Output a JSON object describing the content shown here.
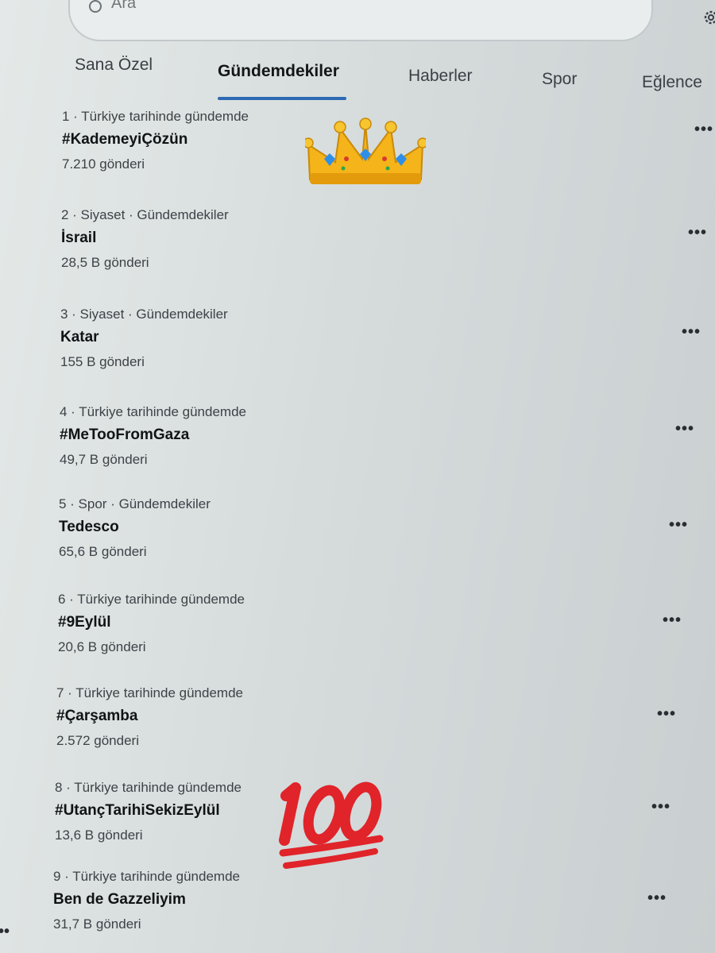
{
  "search": {
    "placeholder": "Ara"
  },
  "tabs": [
    {
      "label": "Sana Özel"
    },
    {
      "label": "Gündemdekiler",
      "active": true
    },
    {
      "label": "Haberler"
    },
    {
      "label": "Spor"
    },
    {
      "label": "Eğlence"
    }
  ],
  "trends": [
    {
      "meta": "1 · Türkiye tarihinde gündemde",
      "name": "#KademeyiÇözün",
      "count": "7.210 gönderi"
    },
    {
      "meta": "2 · Siyaset · Gündemdekiler",
      "name": "İsrail",
      "count": "28,5 B gönderi"
    },
    {
      "meta": "3 · Siyaset · Gündemdekiler",
      "name": "Katar",
      "count": "155 B gönderi"
    },
    {
      "meta": "4 · Türkiye tarihinde gündemde",
      "name": "#MeTooFromGaza",
      "count": "49,7 B gönderi"
    },
    {
      "meta": "5 · Spor · Gündemdekiler",
      "name": "Tedesco",
      "count": "65,6 B gönderi"
    },
    {
      "meta": "6 · Türkiye tarihinde gündemde",
      "name": "#9Eylül",
      "count": "20,6 B gönderi"
    },
    {
      "meta": "7 · Türkiye tarihinde gündemde",
      "name": "#Çarşamba",
      "count": "2.572 gönderi"
    },
    {
      "meta": "8 · Türkiye tarihinde gündemde",
      "name": "#UtançTarihiSekizEylül",
      "count": "13,6 B gönderi"
    },
    {
      "meta": "9 · Türkiye tarihinde gündemde",
      "name": "Ben de Gazzeliyim",
      "count": "31,7 B gönderi"
    }
  ],
  "more_label": "•••",
  "stickers": {
    "crown": "crown-emoji",
    "hundred": "hundred-points-emoji"
  },
  "colors": {
    "accent": "#2d6ab3",
    "hundred_red": "#e0242a",
    "crown_gold": "#f4b41a"
  }
}
